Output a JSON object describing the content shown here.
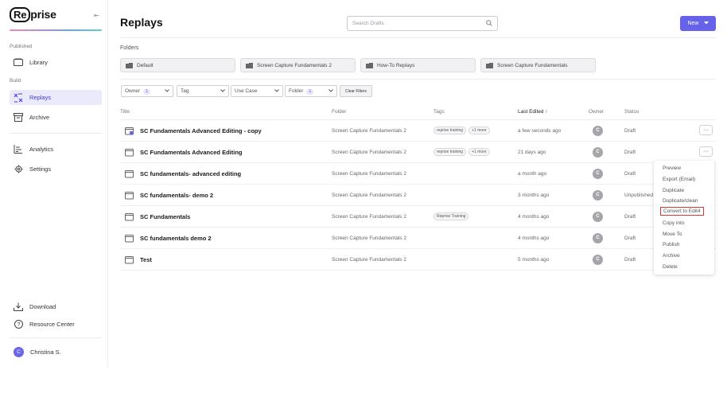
{
  "brand": {
    "logo_left": "Re",
    "logo_right": "prise",
    "collapse_glyph": "⇤"
  },
  "sidebar": {
    "published_label": "Published",
    "build_label": "Build",
    "items": [
      {
        "label": "Library",
        "icon": "library-icon"
      },
      {
        "label": "Replays",
        "icon": "replays-icon",
        "active": true
      },
      {
        "label": "Archive",
        "icon": "archive-icon"
      },
      {
        "label": "Analytics",
        "icon": "analytics-icon"
      },
      {
        "label": "Settings",
        "icon": "gear-icon"
      }
    ],
    "bottom": [
      {
        "label": "Download",
        "icon": "download-icon"
      },
      {
        "label": "Resource Center",
        "icon": "help-icon"
      }
    ],
    "user": {
      "initial": "C",
      "name": "Christina S."
    }
  },
  "header": {
    "title": "Replays",
    "search_placeholder": "Search Drafts",
    "new_label": "New"
  },
  "folders": {
    "label": "Folders",
    "items": [
      "Default",
      "Screen Capture Fundamentals 2",
      "How-To Replays",
      "Screen Capture Fundamentals"
    ]
  },
  "filters": {
    "owner": {
      "label": "Owner",
      "count": "1"
    },
    "tag": {
      "label": "Tag"
    },
    "use_case": {
      "label": "Use Case"
    },
    "folder": {
      "label": "Folder",
      "count": "1"
    },
    "clear_label": "Clear Filters"
  },
  "table": {
    "headers": {
      "title": "Title",
      "folder": "Folder",
      "tags": "Tags",
      "last_edited": "Last Edited ↑",
      "owner": "Owner",
      "status": "Status"
    },
    "rows": [
      {
        "title": "SC Fundamentals Advanced Editing - copy",
        "folder": "Screen Capture Fundamentals 2",
        "tag1": "reprise training",
        "tag2": "+1 more",
        "edited": "a few seconds ago",
        "owner": "C",
        "status": "Draft"
      },
      {
        "title": "SC Fundamentals Advanced Editing",
        "folder": "Screen Capture Fundamentals 2",
        "tag1": "reprise training",
        "tag2": "+1 more",
        "edited": "21 days ago",
        "owner": "C",
        "status": "Draft"
      },
      {
        "title": "SC fundamentals- advanced editing",
        "folder": "Screen Capture Fundamentals 2",
        "tag1": "",
        "tag2": "",
        "edited": "a month ago",
        "owner": "C",
        "status": "Draft"
      },
      {
        "title": "SC fundamentals- demo 2",
        "folder": "Screen Capture Fundamentals 2",
        "tag1": "",
        "tag2": "",
        "edited": "3 months ago",
        "owner": "C",
        "status": "Unpublished"
      },
      {
        "title": "SC Fundamentals",
        "folder": "Screen Capture Fundamentals 2",
        "tag1": "Reprise Training",
        "tag2": "",
        "edited": "4 months ago",
        "owner": "C",
        "status": "Draft"
      },
      {
        "title": "SC fundamentals demo 2",
        "folder": "Screen Capture Fundamentals 2",
        "tag1": "",
        "tag2": "",
        "edited": "4 months ago",
        "owner": "C",
        "status": "Draft"
      },
      {
        "title": "Test",
        "folder": "Screen Capture Fundamentals 2",
        "tag1": "",
        "tag2": "",
        "edited": "5 months ago",
        "owner": "C",
        "status": "Draft"
      }
    ],
    "more_glyph": "···"
  },
  "context_menu": {
    "items": [
      "Preview",
      "Export (Email)",
      "Duplicate",
      "Duplicate/clean",
      "Convert to Edit4",
      "Copy into",
      "Move To",
      "Publish",
      "Archive",
      "Delete"
    ]
  },
  "colors": {
    "accent": "#6762ea",
    "unpublished": "#e2a100",
    "highlight_border": "#d23a3a"
  }
}
